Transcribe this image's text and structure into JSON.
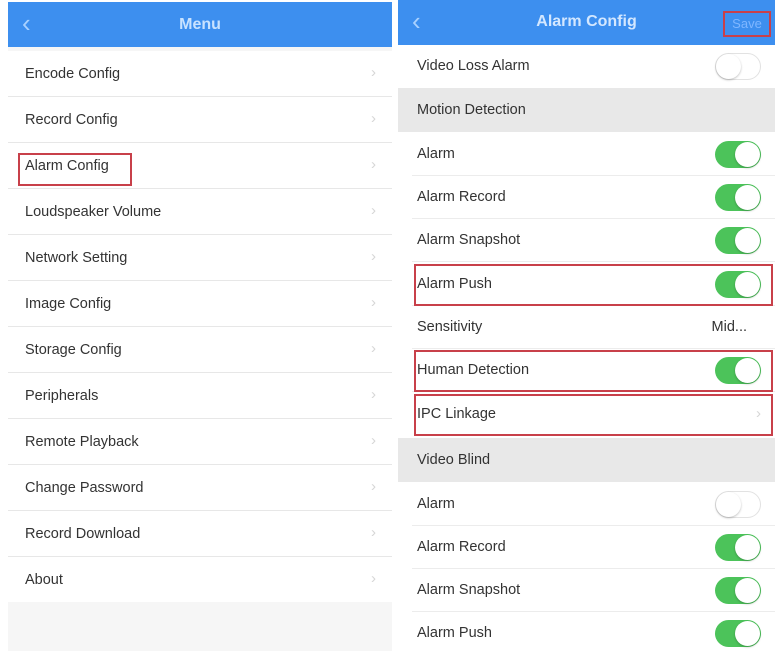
{
  "menu_panel": {
    "title": "Menu",
    "back_glyph": "‹",
    "items": [
      {
        "label": "Encode Config"
      },
      {
        "label": "Record Config"
      },
      {
        "label": "Alarm Config"
      },
      {
        "label": "Loudspeaker Volume"
      },
      {
        "label": "Network Setting"
      },
      {
        "label": "Image Config"
      },
      {
        "label": "Storage Config"
      },
      {
        "label": "Peripherals"
      },
      {
        "label": "Remote Playback"
      },
      {
        "label": "Change Password"
      },
      {
        "label": "Record Download"
      },
      {
        "label": "About"
      }
    ]
  },
  "alarm_panel": {
    "title": "Alarm Config",
    "back_glyph": "‹",
    "save_label": "Save",
    "video_loss_alarm": {
      "label": "Video Loss Alarm",
      "on": false
    },
    "motion_detection": {
      "section_label": "Motion Detection",
      "alarm": {
        "label": "Alarm",
        "on": true
      },
      "alarm_record": {
        "label": "Alarm Record",
        "on": true
      },
      "alarm_snapshot": {
        "label": "Alarm Snapshot",
        "on": true
      },
      "alarm_push": {
        "label": "Alarm Push",
        "on": true
      },
      "sensitivity": {
        "label": "Sensitivity",
        "value": "Mid..."
      },
      "human_detection": {
        "label": "Human Detection",
        "on": true
      },
      "ipc_linkage": {
        "label": "IPC Linkage"
      }
    },
    "video_blind": {
      "section_label": "Video Blind",
      "alarm": {
        "label": "Alarm",
        "on": false
      },
      "alarm_record": {
        "label": "Alarm Record",
        "on": true
      },
      "alarm_snapshot": {
        "label": "Alarm Snapshot",
        "on": true
      },
      "alarm_push": {
        "label": "Alarm Push",
        "on": true
      }
    }
  },
  "colors": {
    "nav_bar": "#3d8fef",
    "toggle_on": "#4cc35a",
    "highlight_border": "#c8404a"
  }
}
